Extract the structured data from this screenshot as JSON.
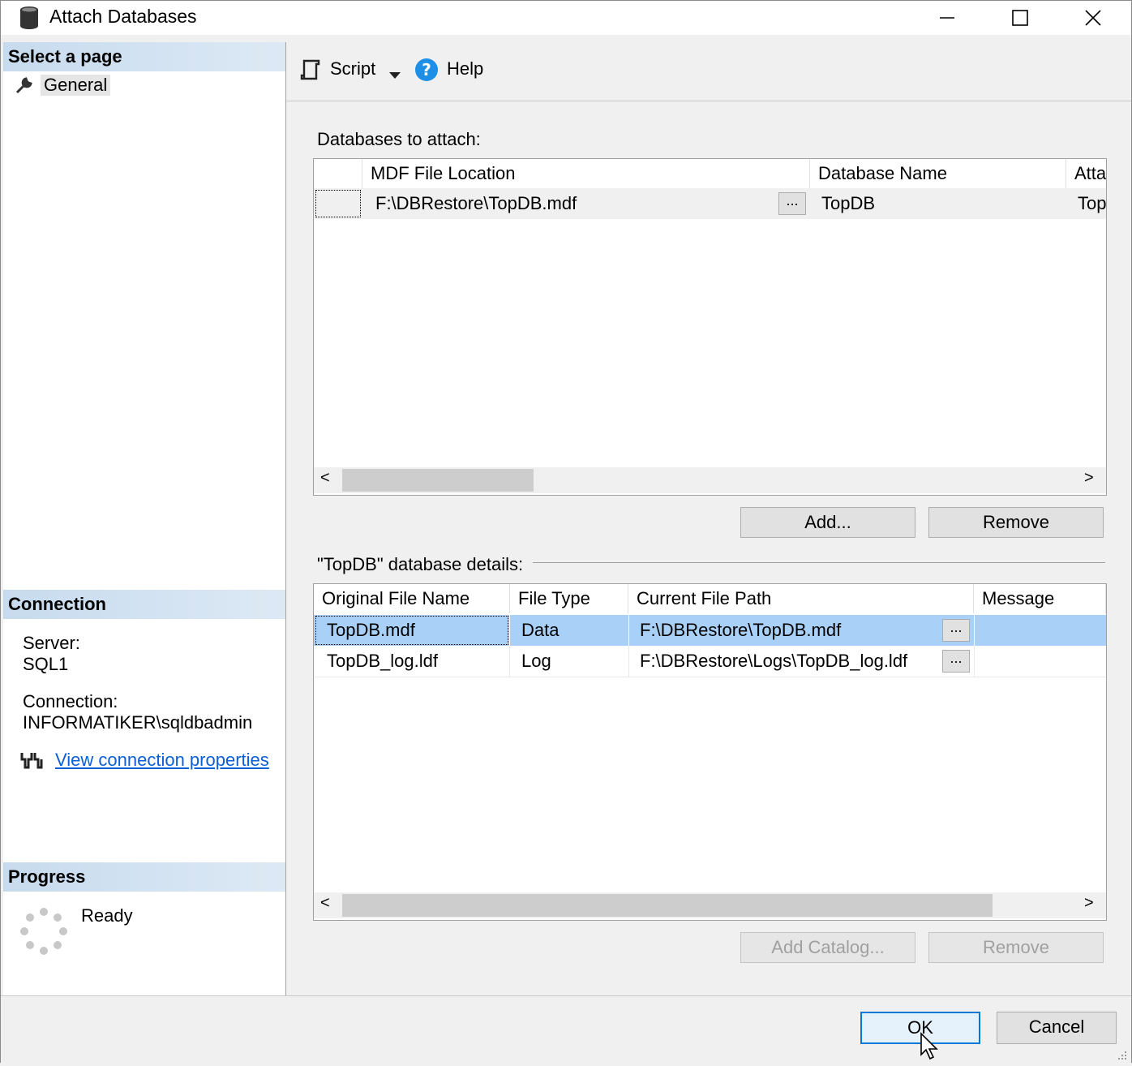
{
  "window": {
    "title": "Attach Databases",
    "minimize_glyph": "—",
    "maximize_glyph": "☐",
    "close_glyph": "✕",
    "icon": "database-icon"
  },
  "left": {
    "select_page_header": "Select a page",
    "pages": [
      {
        "label": "General",
        "icon": "wrench-icon"
      }
    ],
    "connection_header": "Connection",
    "server_label": "Server:",
    "server_value": "SQL1",
    "connection_label": "Connection:",
    "connection_value": "INFORMATIKER\\sqldbadmin",
    "view_connection_link": "View connection properties",
    "progress_header": "Progress",
    "progress_status": "Ready"
  },
  "toolbar": {
    "script_label": "Script",
    "help_label": "Help"
  },
  "attach": {
    "label": "Databases to attach:",
    "columns": [
      "MDF File Location",
      "Database Name",
      "Atta"
    ],
    "rows": [
      {
        "mdf": "F:\\DBRestore\\TopDB.mdf",
        "browse": "...",
        "dbname": "TopDB",
        "attach_as": "Top"
      }
    ],
    "scroll_left": "<",
    "scroll_right": ">",
    "add_button": "Add...",
    "remove_button": "Remove"
  },
  "details": {
    "label": "\"TopDB\" database details:",
    "columns": [
      "Original File Name",
      "File Type",
      "Current File Path",
      "Message"
    ],
    "rows": [
      {
        "name": "TopDB.mdf",
        "type": "Data",
        "path": "F:\\DBRestore\\TopDB.mdf",
        "browse": "...",
        "message": "",
        "selected": true
      },
      {
        "name": "TopDB_log.ldf",
        "type": "Log",
        "path": "F:\\DBRestore\\Logs\\TopDB_log.ldf",
        "browse": "...",
        "message": "",
        "selected": false
      }
    ],
    "scroll_left": "<",
    "scroll_right": ">",
    "add_catalog_button": "Add Catalog...",
    "remove_button": "Remove"
  },
  "footer": {
    "ok_button": "OK",
    "cancel_button": "Cancel"
  },
  "colors": {
    "selection": "#a9d1f7",
    "section_header": "#c7dbee",
    "link": "#0a5fd6",
    "ok_border": "#0078d7"
  }
}
